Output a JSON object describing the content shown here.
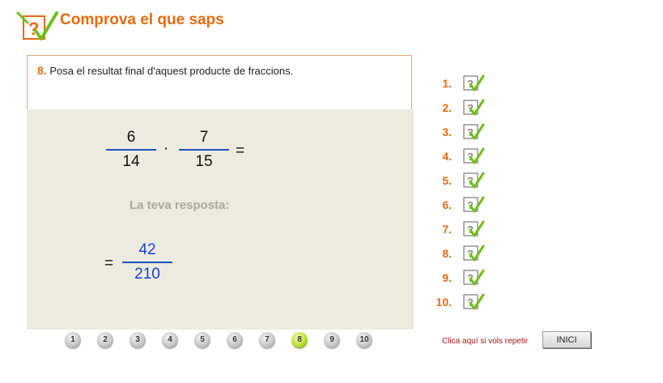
{
  "header": {
    "title": "Comprova el que saps",
    "logo_icon": "question-check-logo-icon"
  },
  "question": {
    "number": "8.",
    "text": "Posa el resultat final d'aquest producte de fraccions."
  },
  "expression": {
    "fraction1": {
      "numerator": "6",
      "denominator": "14"
    },
    "operator": "·",
    "fraction2": {
      "numerator": "7",
      "denominator": "15"
    },
    "equals": "="
  },
  "answer": {
    "label": "La teva resposta:",
    "equals": "=",
    "numerator": "42",
    "denominator": "210"
  },
  "answers_list": [
    {
      "label": "1.",
      "status": "correct"
    },
    {
      "label": "2.",
      "status": "correct"
    },
    {
      "label": "3.",
      "status": "correct"
    },
    {
      "label": "4.",
      "status": "correct"
    },
    {
      "label": "5.",
      "status": "correct"
    },
    {
      "label": "6.",
      "status": "correct"
    },
    {
      "label": "7.",
      "status": "correct"
    },
    {
      "label": "8.",
      "status": "correct"
    },
    {
      "label": "9.",
      "status": "correct"
    },
    {
      "label": "10.",
      "status": "correct"
    }
  ],
  "navigation": {
    "pages": [
      "1",
      "2",
      "3",
      "4",
      "5",
      "6",
      "7",
      "8",
      "9",
      "10"
    ],
    "active": "8"
  },
  "footer": {
    "repeat_text": "Clica aquí si vols repetir",
    "inici_label": "INICI"
  },
  "colors": {
    "accent": "#e86a10",
    "answer_blue": "#1a3fd6",
    "work_bg": "#ebebdf",
    "check_green": "#6fbf1a"
  }
}
